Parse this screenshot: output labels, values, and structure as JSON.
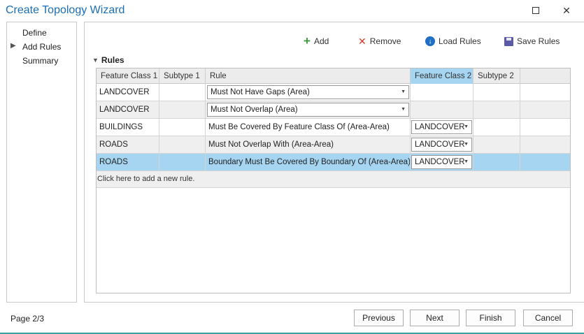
{
  "window": {
    "title": "Create Topology Wizard"
  },
  "steps": [
    {
      "label": "Define",
      "current": false
    },
    {
      "label": "Add Rules",
      "current": true
    },
    {
      "label": "Summary",
      "current": false
    }
  ],
  "toolbar": {
    "add_label": "Add",
    "remove_label": "Remove",
    "load_label": "Load Rules",
    "save_label": "Save Rules"
  },
  "section": {
    "title": "Rules"
  },
  "table": {
    "columns": [
      "Feature Class 1",
      "Subtype 1",
      "Rule",
      "Feature Class 2",
      "Subtype 2",
      ""
    ],
    "selected_column": "Feature Class 2",
    "rows": [
      {
        "fc1": "LANDCOVER",
        "sub1": "",
        "rule": "Must Not Have Gaps (Area)",
        "rule_dropdown": true,
        "fc2": "",
        "sub2": "",
        "selected": false
      },
      {
        "fc1": "LANDCOVER",
        "sub1": "",
        "rule": "Must Not Overlap (Area)",
        "rule_dropdown": true,
        "fc2": "",
        "sub2": "",
        "selected": false
      },
      {
        "fc1": "BUILDINGS",
        "sub1": "",
        "rule": "Must Be Covered By Feature Class Of (Area-Area)",
        "rule_dropdown": false,
        "fc2": "LANDCOVER",
        "sub2": "",
        "selected": false
      },
      {
        "fc1": "ROADS",
        "sub1": "",
        "rule": "Must Not Overlap With (Area-Area)",
        "rule_dropdown": false,
        "fc2": "LANDCOVER",
        "sub2": "",
        "selected": false
      },
      {
        "fc1": "ROADS",
        "sub1": "",
        "rule": "Boundary Must Be Covered By Boundary Of (Area-Area)",
        "rule_dropdown": false,
        "fc2": "LANDCOVER",
        "sub2": "",
        "selected": true
      }
    ],
    "add_rule_text": "Click here to add a new rule."
  },
  "footer": {
    "page_label": "Page 2/3",
    "previous_label": "Previous",
    "next_label": "Next",
    "finish_label": "Finish",
    "cancel_label": "Cancel"
  },
  "colors": {
    "title": "#1a6fb5",
    "selection": "#a5d5f0",
    "add_icon": "#3a9a3a",
    "remove_icon": "#d03a2a",
    "load_icon": "#1f6fc4",
    "save_icon": "#5a5aa8"
  }
}
